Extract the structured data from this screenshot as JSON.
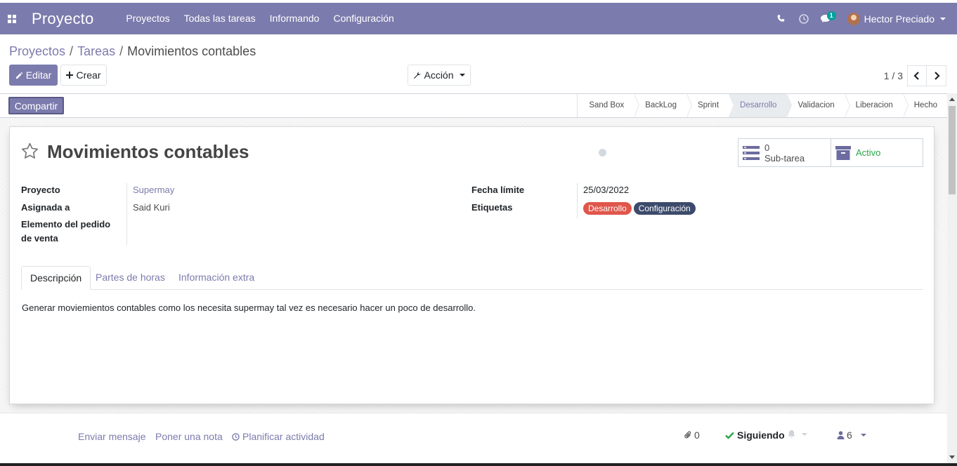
{
  "navbar": {
    "brand": "Proyecto",
    "menu": [
      "Proyectos",
      "Todas las tareas",
      "Informando",
      "Configuración"
    ],
    "messages_badge": "1",
    "user_name": "Hector Preciado",
    "color": "#7c7bad"
  },
  "breadcrumb": {
    "items": [
      "Proyectos",
      "Tareas",
      "Movimientos contables"
    ],
    "separator": "/"
  },
  "buttons": {
    "edit": "Editar",
    "create": "Crear",
    "action": "Acción",
    "share": "Compartir"
  },
  "pager": {
    "value": "1 / 3"
  },
  "stages": {
    "items": [
      "Sand Box",
      "BackLog",
      "Sprint",
      "Desarrollo",
      "Validacion",
      "Liberacion",
      "Hecho"
    ],
    "active": "Desarrollo"
  },
  "record": {
    "title": "Movimientos contables",
    "subtasks_count": "0",
    "subtasks_label": "Sub-tarea",
    "active_label": "Activo"
  },
  "fields": {
    "project_label": "Proyecto",
    "project_value": "Supermay",
    "assigned_label": "Asignada a",
    "assigned_value": "Said Kuri",
    "sale_line_label": "Elemento del pedido de venta",
    "deadline_label": "Fecha límite",
    "deadline_value": "25/03/2022",
    "tags_label": "Etiquetas",
    "tags": [
      {
        "name": "Desarrollo",
        "color": "#e0564b"
      },
      {
        "name": "Configuración",
        "color": "#3c4a6b"
      }
    ]
  },
  "tabs": {
    "items": [
      "Descripción",
      "Partes de horas",
      "Información extra"
    ],
    "active": "Descripción"
  },
  "description": "Generar moviemientos contables como los necesita supermay tal vez es necesario hacer un poco de desarrollo.",
  "chatter": {
    "send_message": "Enviar mensaje",
    "log_note": "Poner una nota",
    "schedule_activity": "Planificar actividad",
    "attachments": "0",
    "following": "Siguiendo",
    "followers": "6"
  }
}
